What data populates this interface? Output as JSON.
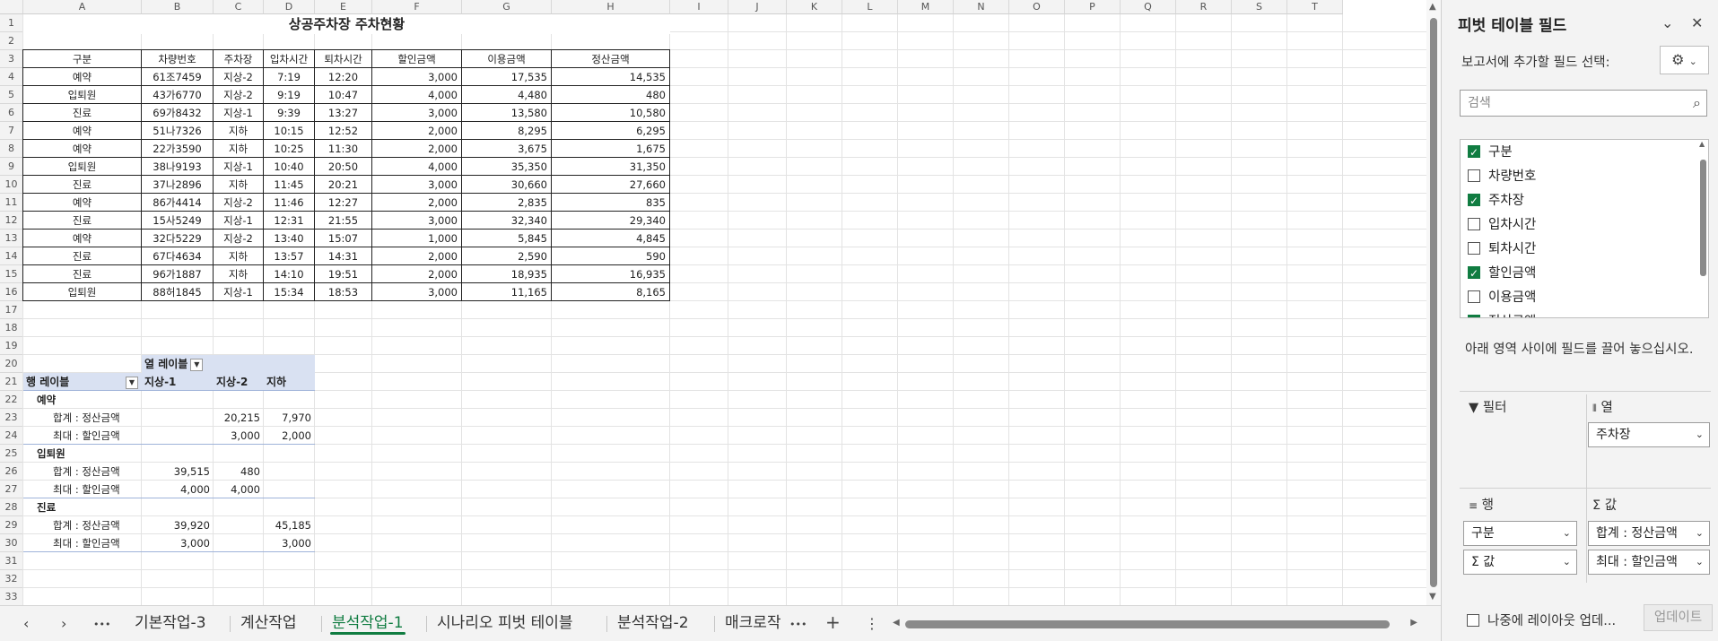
{
  "sheet": {
    "columns": [
      "A",
      "B",
      "C",
      "D",
      "E",
      "F",
      "G",
      "H",
      "I",
      "J",
      "K",
      "L",
      "M",
      "N",
      "O",
      "P",
      "Q",
      "R",
      "S",
      "T"
    ],
    "rows": [
      "1",
      "2",
      "3",
      "4",
      "5",
      "6",
      "7",
      "8",
      "9",
      "10",
      "11",
      "12",
      "13",
      "14",
      "15",
      "16",
      "17",
      "18",
      "19",
      "20",
      "21",
      "22",
      "23",
      "24",
      "25",
      "26",
      "27",
      "28",
      "29",
      "30",
      "31",
      "32",
      "33"
    ],
    "title": "상공주차장 주차현황",
    "table": {
      "headers": [
        "구분",
        "차량번호",
        "주차장",
        "입차시간",
        "퇴차시간",
        "할인금액",
        "이용금액",
        "정산금액"
      ],
      "rows": [
        [
          "예약",
          "61조7459",
          "지상-2",
          "7:19",
          "12:20",
          "3,000",
          "17,535",
          "14,535"
        ],
        [
          "입퇴원",
          "43가6770",
          "지상-2",
          "9:19",
          "10:47",
          "4,000",
          "4,480",
          "480"
        ],
        [
          "진료",
          "69가8432",
          "지상-1",
          "9:39",
          "13:27",
          "3,000",
          "13,580",
          "10,580"
        ],
        [
          "예약",
          "51나7326",
          "지하",
          "10:15",
          "12:52",
          "2,000",
          "8,295",
          "6,295"
        ],
        [
          "예약",
          "22가3590",
          "지하",
          "10:25",
          "11:30",
          "2,000",
          "3,675",
          "1,675"
        ],
        [
          "입퇴원",
          "38나9193",
          "지상-1",
          "10:40",
          "20:50",
          "4,000",
          "35,350",
          "31,350"
        ],
        [
          "진료",
          "37나2896",
          "지하",
          "11:45",
          "20:21",
          "3,000",
          "30,660",
          "27,660"
        ],
        [
          "예약",
          "86가4414",
          "지상-2",
          "11:46",
          "12:27",
          "2,000",
          "2,835",
          "835"
        ],
        [
          "진료",
          "15사5249",
          "지상-1",
          "12:31",
          "21:55",
          "3,000",
          "32,340",
          "29,340"
        ],
        [
          "예약",
          "32다5229",
          "지상-2",
          "13:40",
          "15:07",
          "1,000",
          "5,845",
          "4,845"
        ],
        [
          "진료",
          "67다4634",
          "지하",
          "13:57",
          "14:31",
          "2,000",
          "2,590",
          "590"
        ],
        [
          "진료",
          "96가1887",
          "지하",
          "14:10",
          "19:51",
          "2,000",
          "18,935",
          "16,935"
        ],
        [
          "입퇴원",
          "88허1845",
          "지상-1",
          "15:34",
          "18:53",
          "3,000",
          "11,165",
          "8,165"
        ]
      ]
    },
    "pivot": {
      "col_label": "열 레이블",
      "row_label": "행 레이블",
      "col_headers": [
        "지상-1",
        "지상-2",
        "지하"
      ],
      "groups": [
        {
          "name": "예약",
          "rows": [
            {
              "label": "합계 : 정산금액",
              "values": [
                "",
                "20,215",
                "7,970"
              ]
            },
            {
              "label": "최대 : 할인금액",
              "values": [
                "",
                "3,000",
                "2,000"
              ]
            }
          ]
        },
        {
          "name": "입퇴원",
          "rows": [
            {
              "label": "합계 : 정산금액",
              "values": [
                "39,515",
                "480",
                ""
              ]
            },
            {
              "label": "최대 : 할인금액",
              "values": [
                "4,000",
                "4,000",
                ""
              ]
            }
          ]
        },
        {
          "name": "진료",
          "rows": [
            {
              "label": "합계 : 정산금액",
              "values": [
                "39,920",
                "",
                "45,185"
              ]
            },
            {
              "label": "최대 : 할인금액",
              "values": [
                "3,000",
                "",
                "3,000"
              ]
            }
          ]
        }
      ]
    }
  },
  "tabs": {
    "nav": {
      "prev": "‹",
      "next": "›",
      "more": "•••",
      "add": "+",
      "menu": "⋮"
    },
    "items": [
      {
        "label": "기본작업-3",
        "active": false
      },
      {
        "label": "계산작업",
        "active": false
      },
      {
        "label": "분석작업-1",
        "active": true
      },
      {
        "label": "시나리오 피벗 테이블",
        "active": false
      },
      {
        "label": "분석작업-2",
        "active": false
      },
      {
        "label": "매크로작",
        "active": false
      }
    ]
  },
  "pane": {
    "title": "피벗 테이블 필드",
    "subtitle": "보고서에 추가할 필드 선택:",
    "search_placeholder": "검색",
    "fields": [
      {
        "label": "구분",
        "checked": true
      },
      {
        "label": "차량번호",
        "checked": false
      },
      {
        "label": "주차장",
        "checked": true
      },
      {
        "label": "입차시간",
        "checked": false
      },
      {
        "label": "퇴차시간",
        "checked": false
      },
      {
        "label": "할인금액",
        "checked": true
      },
      {
        "label": "이용금액",
        "checked": false
      },
      {
        "label": "정산금액",
        "checked": true
      }
    ],
    "drag_hint": "아래 영역 사이에 필드를 끌어 놓으십시오.",
    "areas": {
      "filter_label": "필터",
      "columns_label": "열",
      "rows_label": "행",
      "values_label": "값",
      "columns_items": [
        "주차장"
      ],
      "rows_items": [
        "구분",
        "Σ 값"
      ],
      "values_items": [
        "합계 : 정산금액",
        "최대 : 할인금액"
      ]
    },
    "defer_label": "나중에 레이아웃 업데...",
    "update_label": "업데이트"
  },
  "colors": {
    "accent": "#107c41",
    "pivot_header": "#d9e1f2"
  }
}
